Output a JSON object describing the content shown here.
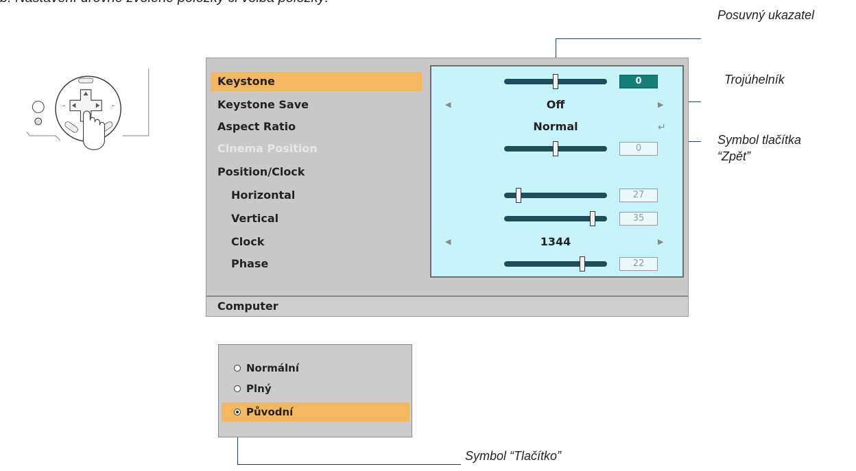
{
  "heading": "b. Nastavení úrovně zvolené položky či volba položky:",
  "callouts": {
    "slider": "Posuvný ukazatel",
    "triangle": "Trojúhelník",
    "return_symbol_line1": "Symbol tlačítka",
    "return_symbol_line2": "“Zpět”",
    "button_symbol": "Symbol “Tlačítko”"
  },
  "osd": {
    "items": [
      {
        "label": "Keystone",
        "state": "selected",
        "control": "slider",
        "level": 0.5,
        "value": "0"
      },
      {
        "label": "Keystone Save",
        "state": "normal",
        "control": "select",
        "value": "Off"
      },
      {
        "label": "Aspect Ratio",
        "state": "normal",
        "control": "enter",
        "value": "Normal"
      },
      {
        "label": "Cinema Position",
        "state": "disabled",
        "control": "slider",
        "level": 0.5,
        "value": "0"
      },
      {
        "label": "Position/Clock",
        "state": "normal",
        "control": "none"
      },
      {
        "label": "Horizontal",
        "state": "normal",
        "control": "slider",
        "level": 0.14,
        "value": "27"
      },
      {
        "label": "Vertical",
        "state": "normal",
        "control": "slider",
        "level": 0.86,
        "value": "35"
      },
      {
        "label": "Clock",
        "state": "normal",
        "control": "select",
        "value": "1344"
      },
      {
        "label": "Phase",
        "state": "normal",
        "control": "slider",
        "level": 0.76,
        "value": "22"
      }
    ],
    "status": "Computer"
  },
  "popup": {
    "options": [
      {
        "label": "Normální",
        "checked": false
      },
      {
        "label": "Plný",
        "checked": false
      },
      {
        "label": "Původní",
        "checked": true
      }
    ]
  },
  "colors": {
    "highlight": "#f4b860",
    "panel": "#c7f3fb",
    "slider": "#1d4e5a",
    "active_value": "#14807a",
    "callout_line": "#1e3e66"
  }
}
